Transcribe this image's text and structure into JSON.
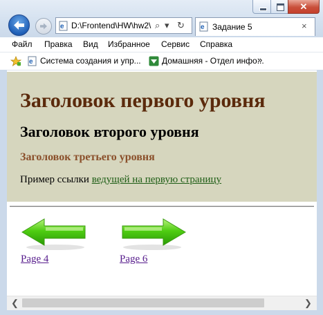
{
  "browser": {
    "address": "D:\\Frontend\\HW\\hw2\\",
    "address_icons": {
      "search": "⌕",
      "dropdown": "▾",
      "refresh": "↻"
    },
    "tab_title": "Задание 5",
    "tab_close": "×",
    "window_controls": {
      "close": "✕"
    },
    "menu": [
      "Файл",
      "Правка",
      "Вид",
      "Избранное",
      "Сервис",
      "Справка"
    ],
    "favorites": [
      "Система создания и упр...",
      "Домашняя - Отдел инфо..."
    ],
    "favorites_more": "»"
  },
  "page": {
    "h1": "Заголовок первого уровня",
    "h2": "Заголовок второго уровня",
    "h3": "Заголовок третьего уровня",
    "paragraph_text": "Пример ссылки ",
    "paragraph_link": "ведущей на первую страницу",
    "prev_link": "Page 4",
    "next_link": "Page 6"
  },
  "scrollbar": {
    "left": "❮",
    "right": "❯"
  },
  "colors": {
    "header_bg": "#d6d6be",
    "h1": "#5b2a0c",
    "h3": "#8a4f2a",
    "link": "#1f5e16",
    "visited_link": "#551a8b",
    "arrow_green": "#3fbf10"
  }
}
